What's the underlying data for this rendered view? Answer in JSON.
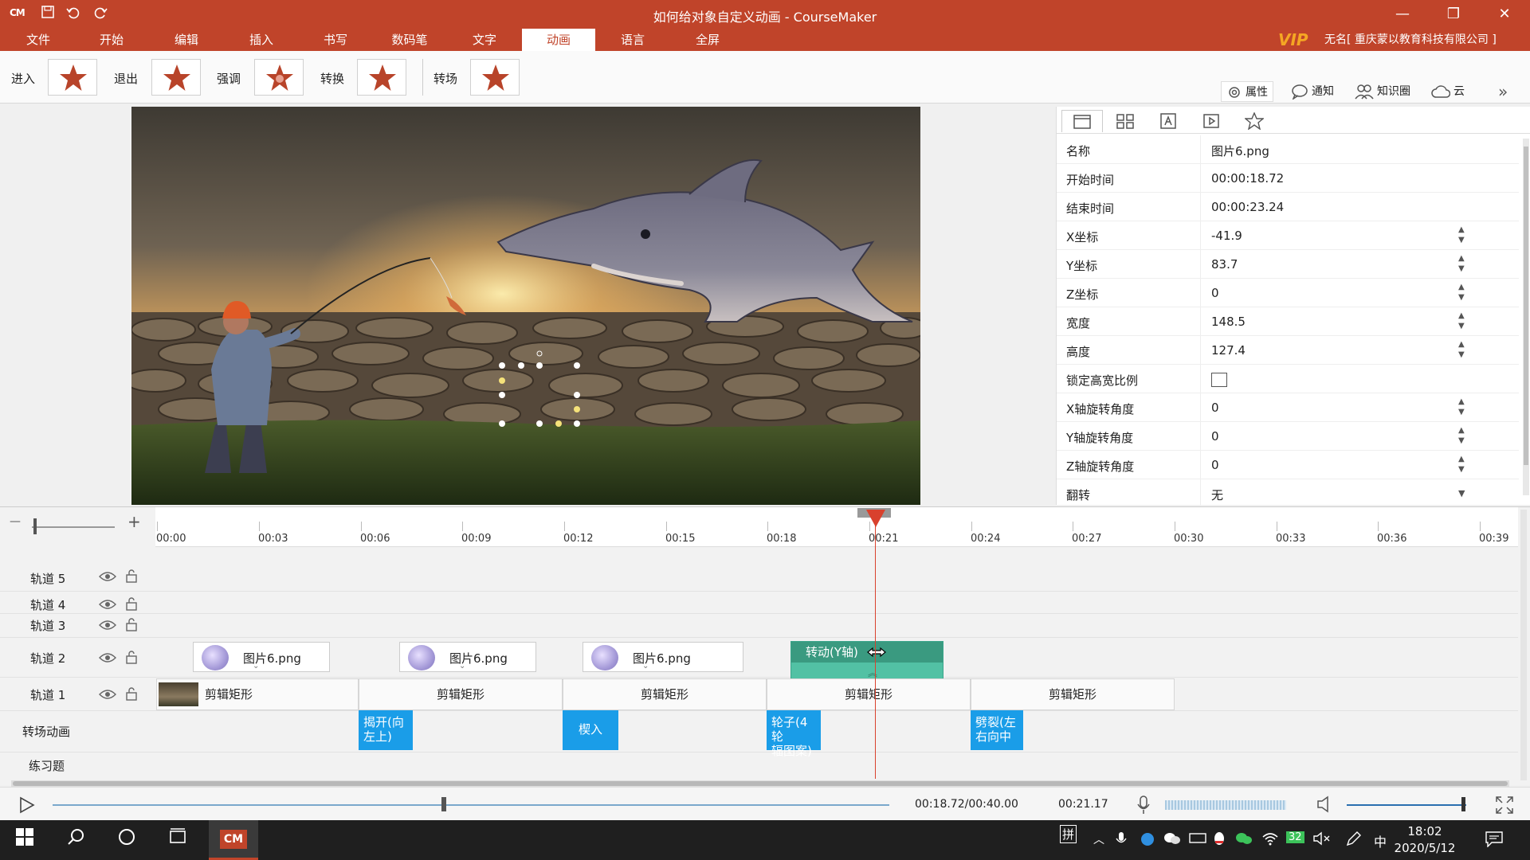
{
  "window": {
    "title": "如何给对象自定义动画 - CourseMaker",
    "logo": "CM",
    "minimize": "—",
    "restore": "❐",
    "close": "✕"
  },
  "menu": [
    "文件",
    "开始",
    "编辑",
    "插入",
    "书写",
    "数码笔",
    "文字",
    "动画",
    "语言",
    "全屏"
  ],
  "menu_active": "动画",
  "account": {
    "vip": "VIP",
    "user": "无名[ 重庆蒙以教育科技有限公司 ]"
  },
  "ribbon": {
    "enter": "进入",
    "exit": "退出",
    "emphasis": "强调",
    "transform": "转换",
    "transition": "转场",
    "properties": "属性",
    "notify": "通知",
    "knowledge": "知识圈",
    "cloud": "云",
    "more": "»"
  },
  "properties": [
    {
      "key": "名称",
      "value": "图片6.png",
      "spinner": false
    },
    {
      "key": "开始时间",
      "value": "00:00:18.72",
      "spinner": false
    },
    {
      "key": "结束时间",
      "value": "00:00:23.24",
      "spinner": false
    },
    {
      "key": "X坐标",
      "value": "-41.9",
      "spinner": true
    },
    {
      "key": "Y坐标",
      "value": "83.7",
      "spinner": true
    },
    {
      "key": "Z坐标",
      "value": "0",
      "spinner": true
    },
    {
      "key": "宽度",
      "value": "148.5",
      "spinner": true
    },
    {
      "key": "高度",
      "value": "127.4",
      "spinner": true
    },
    {
      "key": "锁定高宽比例",
      "value": "",
      "checkbox": true
    },
    {
      "key": "X轴旋转角度",
      "value": "0",
      "spinner": true
    },
    {
      "key": "Y轴旋转角度",
      "value": "0",
      "spinner": true
    },
    {
      "key": "Z轴旋转角度",
      "value": "0",
      "spinner": true
    },
    {
      "key": "翻转",
      "value": "无",
      "dropdown": true
    }
  ],
  "timeline": {
    "zoom_minus": "—",
    "zoom_plus": "+",
    "ticks": [
      "00:00",
      "00:03",
      "00:06",
      "00:09",
      "00:12",
      "00:15",
      "00:18",
      "00:21",
      "00:24",
      "00:27",
      "00:30",
      "00:33",
      "00:36",
      "00:39"
    ],
    "tracks": [
      "轨道 5",
      "轨道 4",
      "轨道 3",
      "轨道 2",
      "轨道 1"
    ],
    "transition_row": "转场动画",
    "exercise_row": "练习题",
    "image_clips": [
      "图片6.png",
      "图片6.png",
      "图片6.png"
    ],
    "anim_clip": "转动(Y轴)",
    "rect_clips": [
      "剪辑矩形",
      "剪辑矩形",
      "剪辑矩形",
      "剪辑矩形",
      "剪辑矩形"
    ],
    "transitions": [
      [
        "揭开(向",
        "左上)"
      ],
      [
        "楔入",
        ""
      ],
      [
        "轮子(4轮",
        "辐图案)"
      ],
      [
        "劈裂(左",
        "右向中"
      ]
    ]
  },
  "player": {
    "current_total": "00:18.72/00:40.00",
    "cursor_time": "00:21.17"
  },
  "taskbar": {
    "ime": "拼",
    "lang": "中",
    "battery": "32",
    "time": "18:02",
    "date": "2020/5/12"
  }
}
